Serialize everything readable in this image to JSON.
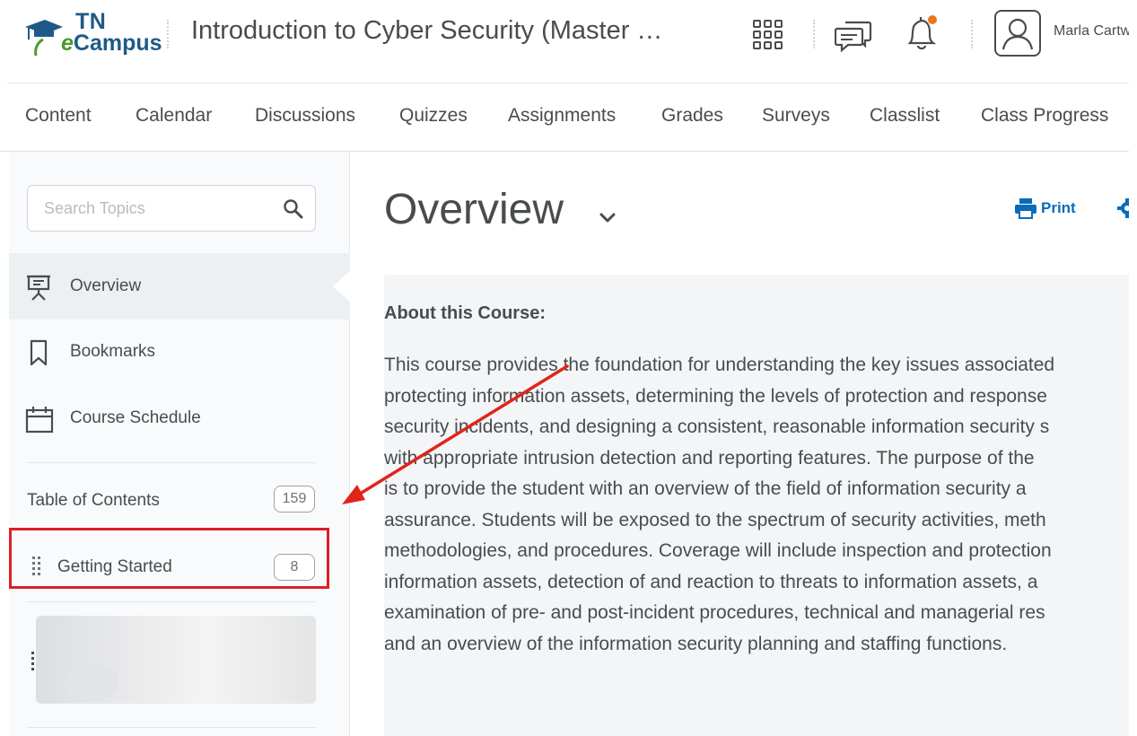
{
  "header": {
    "logo_top": "TN",
    "logo_e": "e",
    "logo_bottom": "Campus",
    "course_title": "Introduction to Cyber Security (Master …",
    "user_name": "Marla Cartw"
  },
  "nav": {
    "items": [
      "Content",
      "Calendar",
      "Discussions",
      "Quizzes",
      "Assignments",
      "Grades",
      "Surveys",
      "Classlist",
      "Class Progress"
    ]
  },
  "sidebar": {
    "search_placeholder": "Search Topics",
    "items": [
      {
        "label": "Overview",
        "icon": "presentation-icon",
        "active": true
      },
      {
        "label": "Bookmarks",
        "icon": "bookmark-icon"
      },
      {
        "label": "Course Schedule",
        "icon": "calendar-icon"
      }
    ],
    "toc_label": "Table of Contents",
    "toc_count": "159",
    "modules": [
      {
        "label": "Getting Started",
        "count": "8",
        "highlighted": true
      }
    ]
  },
  "main": {
    "page_title": "Overview",
    "print_label": "Print",
    "about_heading": "About this Course:",
    "paragraph_lines": [
      "This course provides the foundation for understanding the key issues associated",
      "protecting information assets, determining the levels of protection and response",
      "security incidents, and designing a consistent, reasonable information security s",
      "with appropriate intrusion detection and reporting features. The purpose of the",
      "is to provide the student with an overview of the field of information security a",
      "assurance. Students will be exposed to the spectrum of security activities, meth",
      "methodologies, and procedures. Coverage will include inspection and protection",
      "information assets, detection of and reaction to threats to information assets, a",
      "examination of pre- and post-incident procedures, technical and managerial res",
      "and an overview of the information security planning and staffing functions."
    ]
  },
  "colors": {
    "accent": "#0a6bb8",
    "highlight_box": "#dc1f26",
    "annotation_arrow": "#e0241b",
    "notification_dot": "#e87722",
    "logo_blue": "#1f5a86",
    "logo_green": "#4a9a2d"
  }
}
